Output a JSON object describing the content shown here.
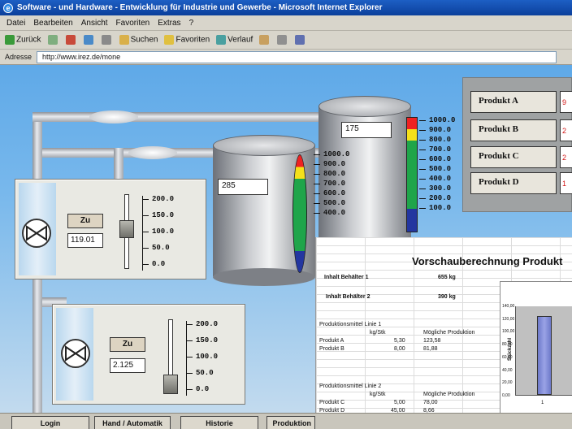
{
  "window": {
    "title": "Software - und Hardware - Entwicklung für Industrie und Gewerbe - Microsoft Internet Explorer"
  },
  "menu": [
    "Datei",
    "Bearbeiten",
    "Ansicht",
    "Favoriten",
    "Extras",
    "?"
  ],
  "toolbar": {
    "back_label": "Zurück",
    "search_label": "Suchen",
    "favorites_label": "Favoriten",
    "history_label": "Verlauf"
  },
  "address": {
    "label": "Adresse",
    "url": "http://www.irez.de/mone"
  },
  "tanks": {
    "tank1": {
      "value": "285",
      "scale": [
        "1000.0",
        "900.0",
        "800.0",
        "700.0",
        "600.0",
        "500.0",
        "400.0"
      ]
    },
    "tank2": {
      "value": "175",
      "scale": [
        "1000.0",
        "900.0",
        "800.0",
        "700.0",
        "600.0",
        "500.0",
        "400.0",
        "300.0",
        "200.0",
        "100.0"
      ]
    }
  },
  "panels": {
    "panel1": {
      "button": "Zu",
      "value": "119.01",
      "scale": [
        "200.0",
        "150.0",
        "100.0",
        "50.0",
        "0.0"
      ]
    },
    "panel2": {
      "button": "Zu",
      "value": "2.125",
      "scale": [
        "200.0",
        "150.0",
        "100.0",
        "50.0",
        "0.0"
      ]
    }
  },
  "products": [
    {
      "label": "Produkt A",
      "value": "9"
    },
    {
      "label": "Produkt B",
      "value": "2"
    },
    {
      "label": "Produkt C",
      "value": "2"
    },
    {
      "label": "Produkt D",
      "value": "1"
    }
  ],
  "sheet": {
    "title": "Vorschauberechnung Produkt",
    "inhalt1_label": "Inhalt Behälter 1",
    "inhalt1_value": "655 kg",
    "inhalt2_label": "Inhalt Behälter 2",
    "inhalt2_value": "390 kg",
    "linie1_label": "Produktionsmittel Linie 1",
    "linie2_label": "Produktionsmittel Linie 2",
    "col_unit": "kg/Stk",
    "col_prod": "Mögliche Produktion",
    "rows1": [
      {
        "name": "Produkt A",
        "unit": "5,30",
        "possible": "123,58"
      },
      {
        "name": "Produkt B",
        "unit": "8,00",
        "possible": "81,88"
      }
    ],
    "rows2": [
      {
        "name": "Produkt C",
        "unit": "5,00",
        "possible": "78,00"
      },
      {
        "name": "Produkt D",
        "unit": "45,00",
        "possible": "8,66"
      }
    ]
  },
  "chart_data": {
    "type": "bar",
    "categories": [
      "1"
    ],
    "series": [
      {
        "values": [
          123.58
        ]
      }
    ],
    "ylabel": "Stückzahl",
    "yticks": [
      "140,00",
      "120,00",
      "100,00",
      "80,00",
      "60,00",
      "40,00",
      "20,00",
      "0,00"
    ],
    "ylim": [
      0,
      140
    ]
  },
  "nav": [
    "Login",
    "Hand / Automatik",
    "Historie",
    "Produktion"
  ]
}
